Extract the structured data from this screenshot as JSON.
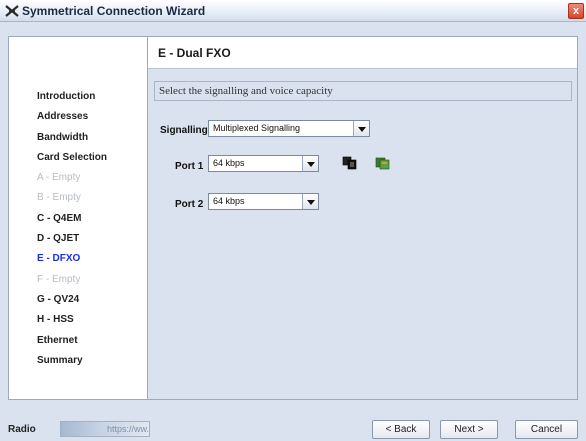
{
  "window": {
    "title": "Symmetrical Connection Wizard",
    "close_glyph": "x"
  },
  "sidebar": {
    "items": [
      {
        "label": "Introduction",
        "state": "done"
      },
      {
        "label": "Addresses",
        "state": "done"
      },
      {
        "label": "Bandwidth",
        "state": "done"
      },
      {
        "label": "Card Selection",
        "state": "done"
      },
      {
        "label": "A - Empty",
        "state": "disabled"
      },
      {
        "label": "B - Empty",
        "state": "disabled"
      },
      {
        "label": "C - Q4EM",
        "state": "done"
      },
      {
        "label": "D - QJET",
        "state": "done"
      },
      {
        "label": "E - DFXO",
        "state": "current"
      },
      {
        "label": "F - Empty",
        "state": "disabled"
      },
      {
        "label": "G - QV24",
        "state": "done"
      },
      {
        "label": "H - HSS",
        "state": "done"
      },
      {
        "label": "Ethernet",
        "state": "done"
      },
      {
        "label": "Summary",
        "state": "done"
      }
    ]
  },
  "main": {
    "title": "E - Dual FXO",
    "instruction": "Select the signalling and voice capacity",
    "signalling": {
      "label": "Signalling",
      "value": "Multiplexed Signalling"
    },
    "port1": {
      "label": "Port 1",
      "value": "64 kbps"
    },
    "port2": {
      "label": "Port 2",
      "value": "64 kbps"
    },
    "port1_icons": [
      "copy-icon",
      "paste-icon"
    ]
  },
  "footer": {
    "radio_label": "Radio",
    "url": "https://ww...",
    "back": "< Back",
    "next": "Next >",
    "cancel": "Cancel"
  },
  "colors": {
    "current_step": "#1a2ee6",
    "disabled_step": "#b7bcc4",
    "background": "#d9e2ee"
  }
}
